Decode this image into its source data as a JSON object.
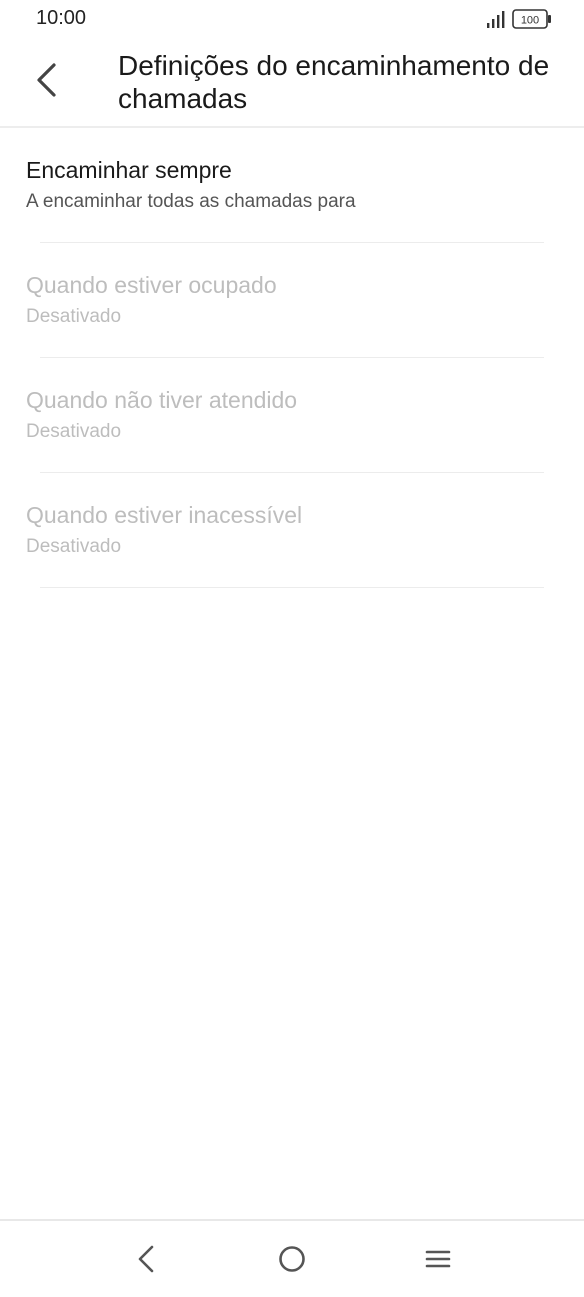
{
  "status_bar": {
    "time": "10:00",
    "battery_level": "100",
    "signal_icon": "signal-bars-icon",
    "battery_icon": "battery-icon"
  },
  "header": {
    "back_icon": "chevron-left-icon",
    "title": "Definições do encaminhamento de chamadas"
  },
  "settings": [
    {
      "title": "Encaminhar sempre",
      "summary": "A encaminhar todas as chamadas para",
      "enabled": true
    },
    {
      "title": "Quando estiver ocupado",
      "summary": "Desativado",
      "enabled": false
    },
    {
      "title": "Quando não tiver atendido",
      "summary": "Desativado",
      "enabled": false
    },
    {
      "title": "Quando estiver inacessível",
      "summary": "Desativado",
      "enabled": false
    }
  ],
  "nav_bar": {
    "back_icon": "nav-back-icon",
    "home_icon": "nav-home-icon",
    "menu_icon": "nav-menu-icon"
  },
  "colors": {
    "background": "#ffffff",
    "text_primary": "#1a1a1a",
    "text_secondary": "#555555",
    "text_disabled": "#bdbdbd",
    "divider": "#ececec"
  }
}
